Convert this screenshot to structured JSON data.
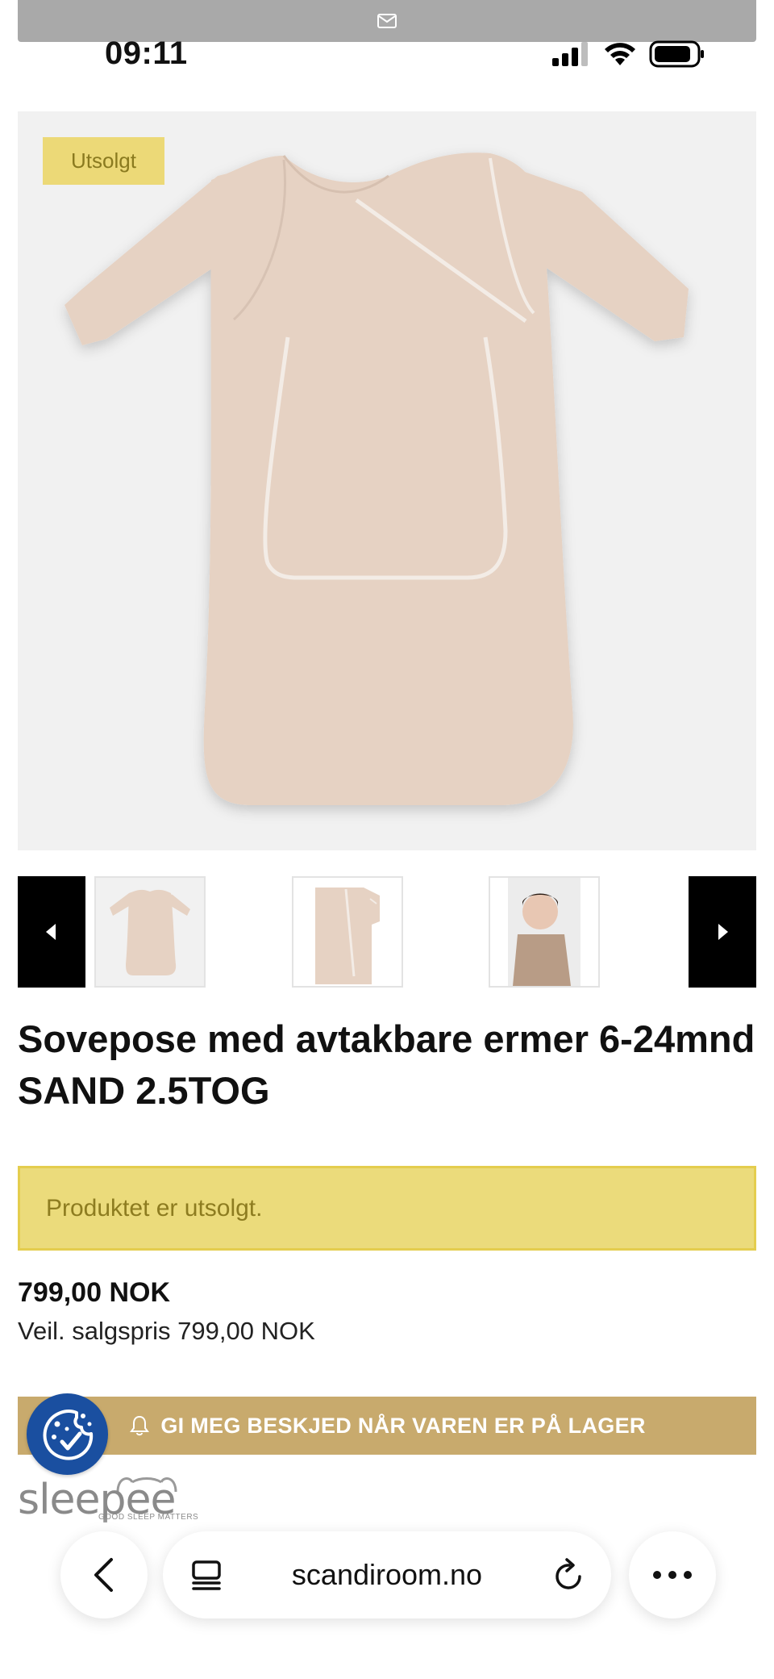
{
  "status_bar": {
    "time": "09:11"
  },
  "product": {
    "badge": "Utsolgt",
    "title": "Sovepose med avtakbare ermer 6-24mnd SAND 2.5TOG",
    "soldout_message": "Produktet er utsolgt.",
    "price": "799,00 NOK",
    "rrp": "Veil. salgspris 799,00 NOK",
    "notify_label": "GI MEG BESKJED NÅR VAREN ER PÅ LAGER",
    "color": "#e6d2c3"
  },
  "brand": {
    "name": "sleepee",
    "tagline": "GOOD SLEEP MATTERS"
  },
  "browser": {
    "url": "scandiroom.no"
  },
  "icons": {
    "notification": "mail-icon",
    "notify": "bell-icon",
    "cookie": "cookie-icon",
    "back": "chevron-left-icon",
    "tabs": "tabs-icon",
    "reload": "reload-icon",
    "more": "more-icon"
  },
  "colors": {
    "badge_bg": "#ecd977",
    "notify_bg": "#c8aa6d",
    "cookie_bg": "#1a4fa0"
  }
}
